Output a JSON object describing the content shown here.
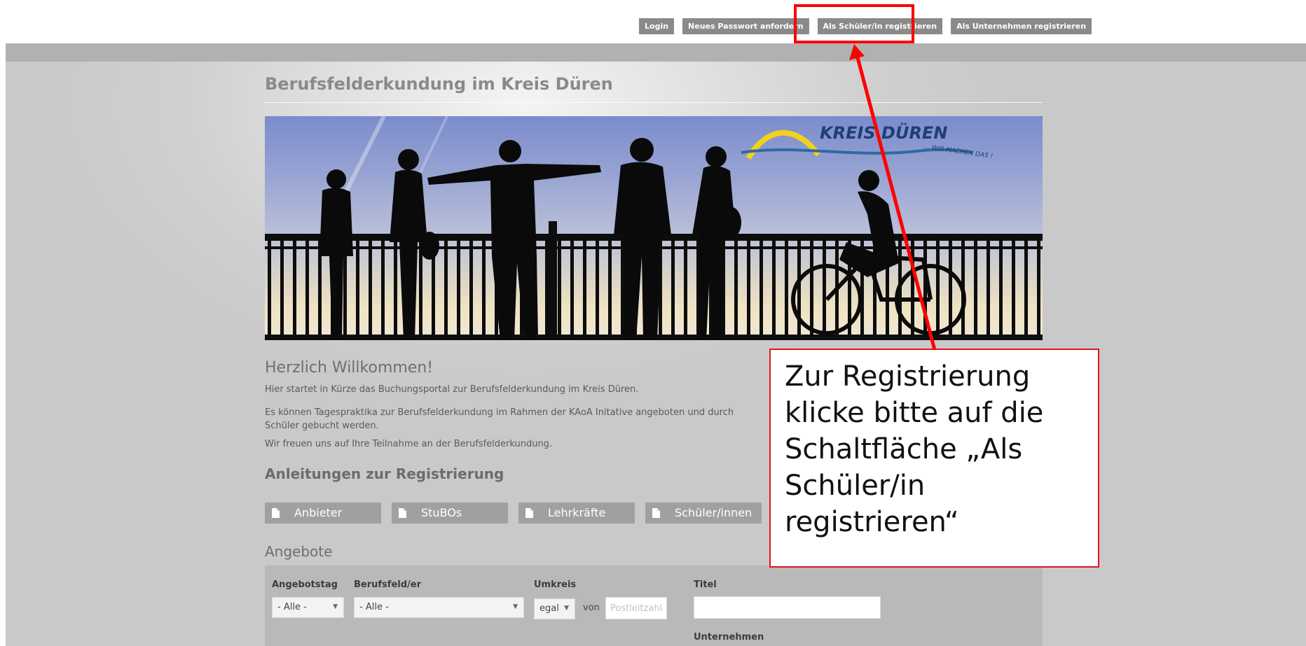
{
  "topnav": {
    "login": "Login",
    "new_password": "Neues Passwort anfordern",
    "register_student": "Als Schüler/in registrieren",
    "register_company": "Als Unternehmen registrieren"
  },
  "site_title": "Berufsfelderkundung im Kreis Düren",
  "banner": {
    "logo_text": "KREIS DÜREN",
    "logo_slogan": "... WIR MACHEN DAS !"
  },
  "welcome": {
    "heading": "Herzlich Willkommen!",
    "p1": "Hier startet in Kürze das Buchungsportal zur Berufsfelderkundung im Kreis Düren.",
    "p2": "Es können Tagespraktika zur Berufsfelderkundung im Rahmen der KAoA Initative angeboten und durch Schüler gebucht werden.",
    "p3": "Wir freuen uns auf Ihre Teilnahme an der Berufsfelderkundung."
  },
  "anleitungen": {
    "heading": "Anleitungen zur Registrierung",
    "buttons": [
      "Anbieter",
      "StuBOs",
      "Lehrkräfte",
      "Schüler/innen"
    ],
    "icon": "document-icon"
  },
  "angebote": {
    "heading": "Angebote",
    "filters": {
      "angebotstag_label": "Angebotstag",
      "angebotstag_value": "- Alle -",
      "berufsfeld_label": "Berufsfeld/er",
      "berufsfeld_value": "- Alle -",
      "umkreis_label": "Umkreis",
      "umkreis_value": "egal",
      "von": "von",
      "postleitzahl_placeholder": "Postleitzahl",
      "titel_label": "Titel",
      "titel_value": "",
      "unternehmen_label": "Unternehmen"
    }
  },
  "callout": {
    "text": "Zur Registrierung klicke bitte auf die Schaltfläche „Als Schüler/in registrieren“",
    "color": "#e0161b"
  }
}
